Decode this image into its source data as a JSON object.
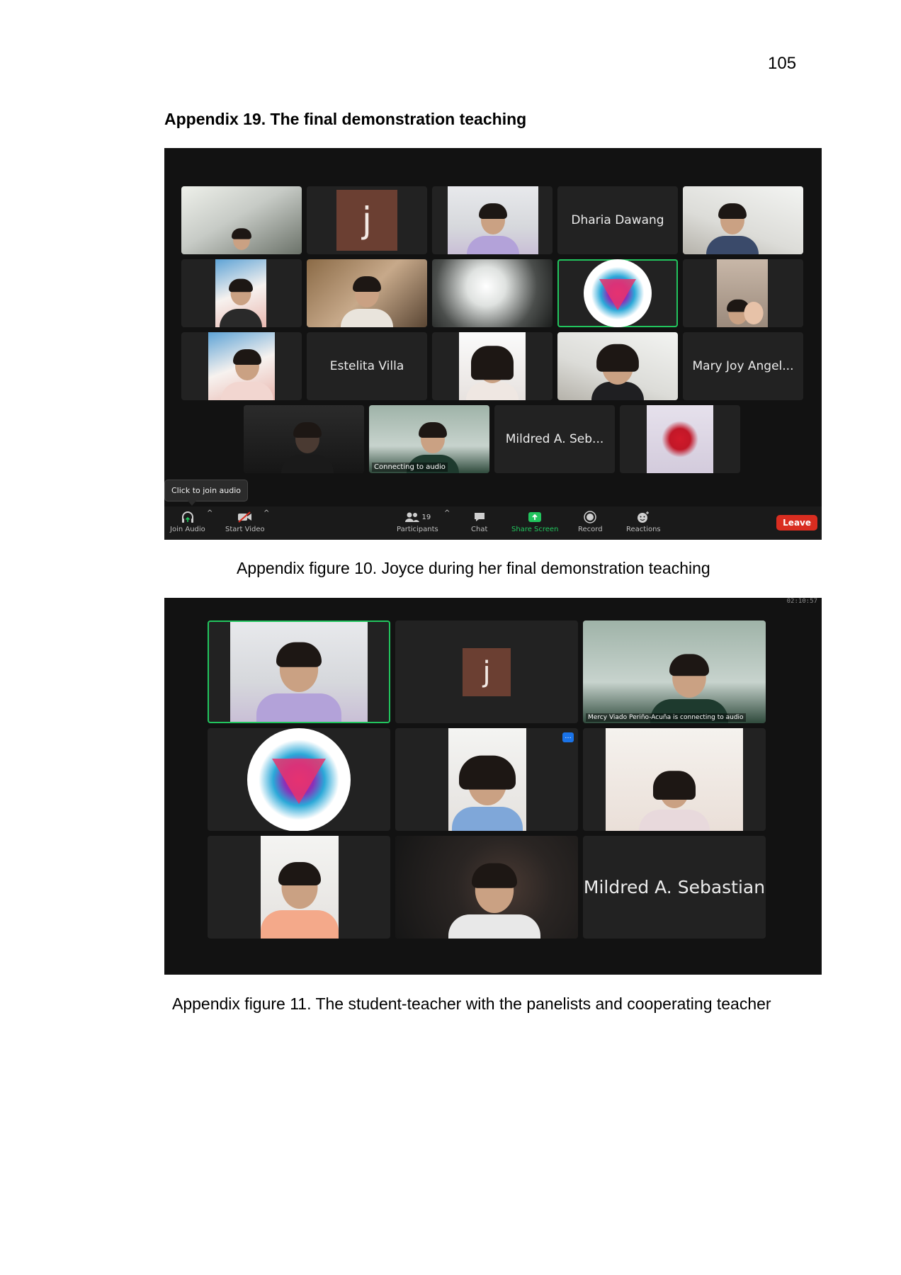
{
  "page_number": "105",
  "appendix_title": "Appendix 19. The final demonstration teaching",
  "figure10": {
    "caption": "Appendix figure 10. Joyce during her final demonstration teaching",
    "avatar_letter": "j",
    "names": {
      "dharia": "Dharia Dawang",
      "estelita": "Estelita Villa",
      "mary_joy": "Mary Joy Angel...",
      "mildred": "Mildred A. Seb..."
    },
    "connecting_status": "Connecting to audio",
    "tooltip": "Click to join audio",
    "toolbar": {
      "join_audio": "Join Audio",
      "start_video": "Start Video",
      "participants": "Participants",
      "participants_count": "19",
      "chat": "Chat",
      "share_screen": "Share Screen",
      "record": "Record",
      "reactions": "Reactions",
      "leave": "Leave"
    },
    "colors": {
      "leave": "#d92d20",
      "share_screen": "#22c55e",
      "active_speaker": "#22c55e"
    }
  },
  "figure11": {
    "caption": "Appendix figure 11. The student-teacher with the panelists and cooperating teacher",
    "avatar_letter": "j",
    "timer": "02:10:57",
    "connecting_status": "Mercy Viado Periño-Acuña is connecting to audio",
    "name_tile": "Mildred A. Sebastian"
  }
}
